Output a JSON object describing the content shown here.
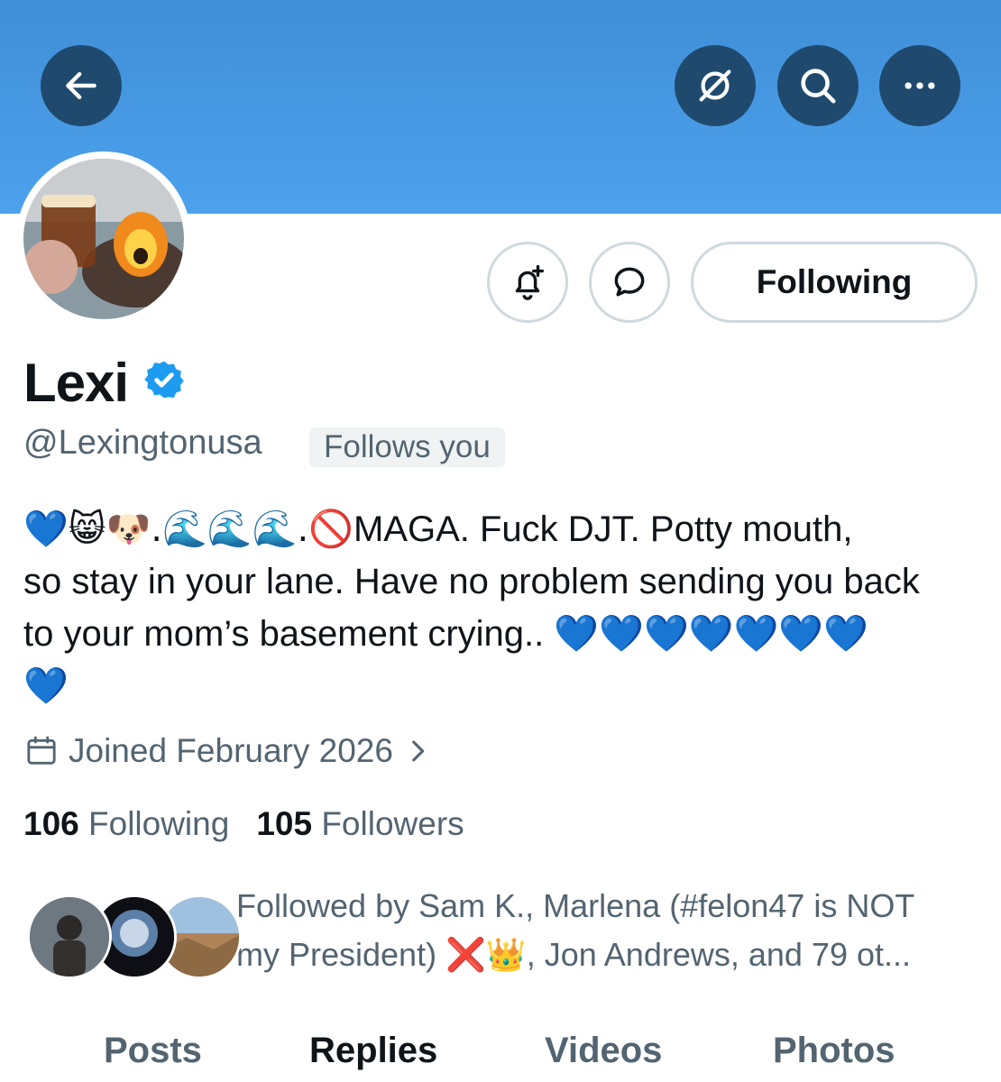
{
  "header": {
    "back_icon": "arrow-left-icon",
    "grok_icon": "slashed-circle-icon",
    "search_icon": "search-icon",
    "more_icon": "more-horizontal-icon",
    "banner_color": "#4da1ee",
    "button_color": "#1f4a6e"
  },
  "actions": {
    "notify_icon": "bell-plus-icon",
    "message_icon": "message-bubble-icon",
    "following_label": "Following"
  },
  "profile": {
    "name": "Lexi",
    "verified_color": "#1d9bf0",
    "handle": "@Lexingtonusa",
    "follows_you": "Follows you",
    "bio_line1_emoji": "💙😸🐶.🌊🌊🌊.🚫",
    "bio_line1_text": "MAGA. Fuck DJT. Potty mouth,",
    "bio_line2": "so stay in your lane. Have no problem sending you back",
    "bio_line3_text": "to your mom’s basement crying.. ",
    "bio_line3_emoji": "💙💙💙💙💙💙💙",
    "bio_line4_emoji": "💙",
    "joined": "Joined February 2026",
    "following_count": "106",
    "following_label": "Following",
    "followers_count": "105",
    "followers_label": "Followers"
  },
  "followed_by": {
    "line1": "Followed by Sam K., Marlena (#felon47 is NOT",
    "line2_a": "my President) ",
    "line2_emoji": "❌👑",
    "line2_b": ", Jon Andrews, and 79 ot..."
  },
  "tabs": [
    "Posts",
    "Replies",
    "Videos",
    "Photos"
  ],
  "active_tab": "Replies"
}
